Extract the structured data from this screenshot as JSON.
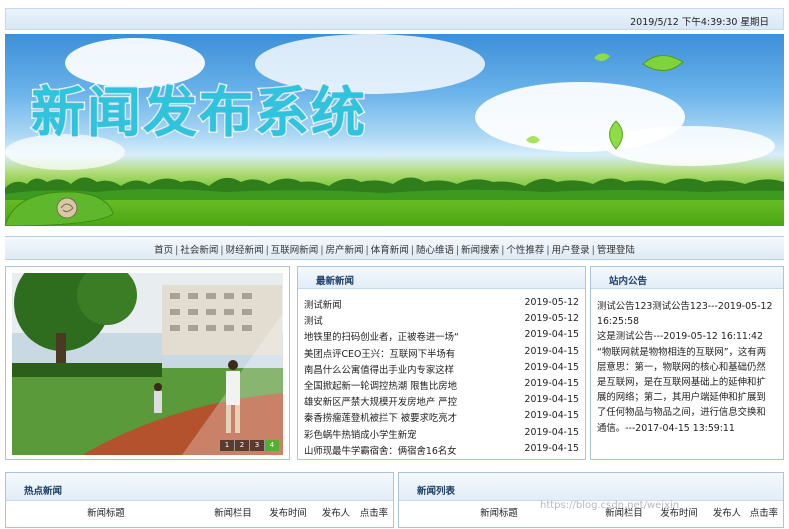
{
  "header": {
    "datetime": "2019/5/12 下午4:39:30  星期日"
  },
  "banner": {
    "title": "新闻发布系统"
  },
  "nav": {
    "items": [
      "首页",
      "社会新闻",
      "财经新闻",
      "互联网新闻",
      "房产新闻",
      "体育新闻",
      "随心维语",
      "新闻搜索",
      "个性推荐",
      "用户登录",
      "管理登陆"
    ]
  },
  "slideshow": {
    "pages": [
      "1",
      "2",
      "3",
      "4"
    ],
    "active_page": 4
  },
  "latest_news": {
    "title": "最新新闻",
    "items": [
      {
        "title": "测试新闻",
        "date": "2019-05-12"
      },
      {
        "title": "测试",
        "date": "2019-05-12"
      },
      {
        "title": "地铁里的扫码创业者，正被卷进一场“",
        "date": "2019-04-15"
      },
      {
        "title": "美团点评CEO王兴：互联网下半场有",
        "date": "2019-04-15"
      },
      {
        "title": "南昌什么公寓值得出手业内专家这样",
        "date": "2019-04-15"
      },
      {
        "title": "全国掀起新一轮调控热潮 限售比房地",
        "date": "2019-04-15"
      },
      {
        "title": "雄安新区严禁大规模开发房地产 严控",
        "date": "2019-04-15"
      },
      {
        "title": "秦香捞瘤莲登机被拦下 被要求吃亮才",
        "date": "2019-04-15"
      },
      {
        "title": "彩色蜗牛热销成小学生新宠",
        "date": "2019-04-15"
      },
      {
        "title": "山师现最牛学霸宿舍：俩宿舍16名女",
        "date": "2019-04-15"
      }
    ]
  },
  "notice": {
    "title": "站内公告",
    "text": "测试公告123测试公告123---2019-05-12 16:25:58\n这是测试公告---2019-05-12 16:11:42\n“物联网就是物物相连的互联网”，这有两层意思：第一，物联网的核心和基础仍然是互联网，是在互联网基础上的延伸和扩展的网络；第二，其用户端延伸和扩展到了任何物品与物品之间，进行信息交换和通信。---2017-04-15 13:59:11"
  },
  "hot_news": {
    "title": "热点新闻",
    "columns": [
      "新闻标题",
      "新闻栏目",
      "发布时间",
      "发布人",
      "点击率"
    ]
  },
  "news_list": {
    "title": "新闻列表",
    "columns": [
      "新闻标题",
      "新闻栏目",
      "发布时间",
      "发布人",
      "点击率"
    ]
  },
  "watermark": "https://blog.csdn.net/weixin_"
}
